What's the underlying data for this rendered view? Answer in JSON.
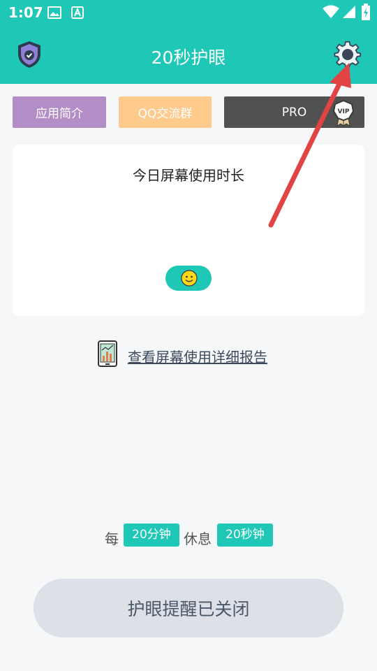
{
  "status_bar": {
    "time": "1:07"
  },
  "app_bar": {
    "title": "20秒护眼"
  },
  "buttons": {
    "intro": "应用简介",
    "qq": "QQ交流群",
    "pro": "PRO",
    "vip": "VIP"
  },
  "card": {
    "title": "今日屏幕使用时长"
  },
  "report": {
    "link": "查看屏幕使用详细报告"
  },
  "schedule": {
    "every": "每",
    "interval": "20分钟",
    "rest": "休息",
    "duration": "20秒钟"
  },
  "toggle": {
    "label": "护眼提醒已关闭"
  },
  "colors": {
    "primary": "#1fc8b6",
    "intro_button": "#b38ec6",
    "qq_button": "#fecb8c",
    "pro_button": "#515151",
    "annotation_arrow": "#e04444"
  },
  "icons": {
    "app_bar_left": "shield-check-icon",
    "app_bar_right": "gear-icon",
    "card_pill": "smiley-icon",
    "report": "phone-chart-icon"
  }
}
